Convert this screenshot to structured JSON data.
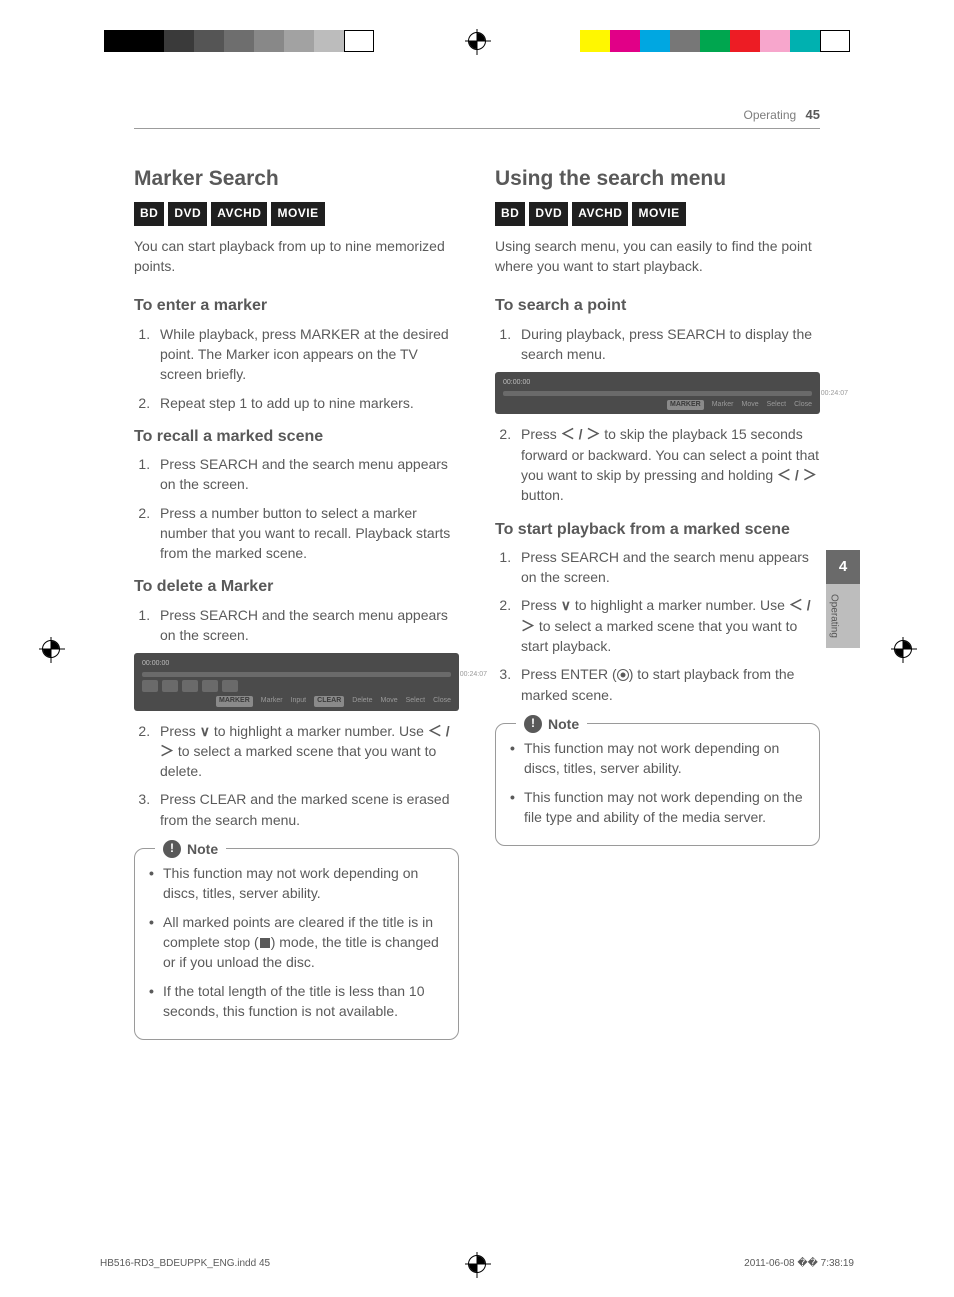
{
  "header": {
    "section": "Operating",
    "page": "45"
  },
  "side_tab": {
    "chapter": "4",
    "label": "Operating"
  },
  "badges": [
    "BD",
    "DVD",
    "AVCHD",
    "MOVIE"
  ],
  "left": {
    "title": "Marker Search",
    "intro": "You can start playback from up to nine memorized points.",
    "sec1": {
      "h": "To enter a marker",
      "items": [
        "While playback, press MARKER at the desired point. The Marker icon appears on the TV screen briefly.",
        "Repeat step 1 to add up to nine markers."
      ]
    },
    "sec2": {
      "h": "To recall a marked scene",
      "items": [
        "Press SEARCH and the search menu appears on the screen.",
        "Press a number button to select a marker number that you want to recall. Playback starts from the marked scene."
      ]
    },
    "sec3": {
      "h": "To delete a Marker",
      "item1": "Press SEARCH and the search menu appears on the screen.",
      "item2a": "Press ",
      "item2b": " to highlight a marker number. Use ",
      "item2c": " to select a marked scene that you want to delete.",
      "item3": "Press CLEAR and the marked scene is erased from the search menu."
    },
    "note": {
      "label": "Note",
      "items": [
        "This function may not work depending on discs, titles, server ability.",
        "All marked points are cleared if the title is in complete stop ( ◼ ) mode, the title is changed or if you unload the disc.",
        "If the total length of the title is less than 10 seconds, this function is not available."
      ]
    },
    "ss": {
      "t1": "00:00:00",
      "t2": "00:24:07",
      "foot": [
        "MARKER",
        "Marker",
        "Input",
        "CLEAR",
        "Delete",
        "Move",
        "Select",
        "Close"
      ]
    }
  },
  "right": {
    "title": "Using the search menu",
    "intro": "Using search menu, you can easily to find the point where you want to start playback.",
    "sec1": {
      "h": "To search a point",
      "item1": "During playback, press SEARCH to display the search menu.",
      "item2a": "Press ",
      "item2b": " to skip the playback 15 seconds forward or backward. You can select a point that you want to skip by pressing and holding ",
      "item2c": " button."
    },
    "sec2": {
      "h": "To start playback from a marked scene",
      "item1": "Press SEARCH and the search menu appears on the screen.",
      "item2a": "Press ",
      "item2b": " to highlight a marker number. Use ",
      "item2c": " to select a marked scene that you want to start playback.",
      "item3a": "Press ENTER (",
      "item3b": ") to start playback from the marked scene."
    },
    "note": {
      "label": "Note",
      "items": [
        "This function may not work depending on discs, titles, server ability.",
        "This function may not work depending on the file type and ability of the media server."
      ]
    },
    "ss": {
      "t1": "00:00:00",
      "t2": "00:24:07",
      "foot": [
        "MARKER",
        "Marker",
        "Move",
        "Select",
        "Close"
      ]
    }
  },
  "symbols": {
    "down": "∨",
    "lr": "＜ / ＞"
  },
  "footer": {
    "left": "HB516-RD3_BDEUPPK_ENG.indd   45",
    "right": "2011-06-08   �� 7:38:19"
  },
  "reg_colors_left": [
    "#000",
    "#000",
    "#3a3a3a",
    "#555",
    "#6e6e6e",
    "#888",
    "#a2a2a2",
    "#bcbcbc",
    "#fff"
  ],
  "reg_colors_right": [
    "#fff700",
    "#e10087",
    "#00a7e1",
    "#777",
    "#00a64f",
    "#ed1c24",
    "#f7a6cc",
    "#00b1b0",
    "#fff"
  ]
}
